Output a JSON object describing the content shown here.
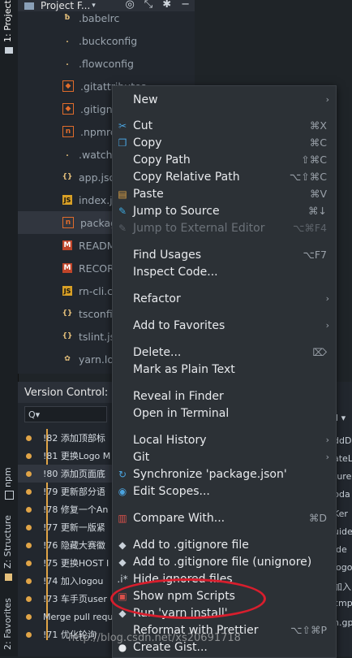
{
  "sidebar": {
    "project_tab": "1: Project",
    "npm_tab": "npm",
    "structure_tab": "Z: Structure",
    "favorites_tab": "2: Favorites"
  },
  "project": {
    "title": "Project F...",
    "files": [
      {
        "name": ".babelrc",
        "icon": "babel-icon"
      },
      {
        "name": ".buckconfig",
        "icon": "config-icon"
      },
      {
        "name": ".flowconfig",
        "icon": "config-icon"
      },
      {
        "name": ".gitattributes",
        "icon": "git-icon"
      },
      {
        "name": ".gitignore",
        "icon": "git-icon"
      },
      {
        "name": ".npmrc",
        "icon": "npm-icon"
      },
      {
        "name": ".watchman",
        "icon": "config-icon"
      },
      {
        "name": "app.json",
        "icon": "json-icon"
      },
      {
        "name": "index.js",
        "icon": "js-icon"
      },
      {
        "name": "package.js",
        "icon": "npm-icon"
      },
      {
        "name": "README.m",
        "icon": "markdown-icon"
      },
      {
        "name": "RECORD.m",
        "icon": "markdown-icon"
      },
      {
        "name": "rn-cli.confi",
        "icon": "js-icon"
      },
      {
        "name": "tsconfig.jsc",
        "icon": "json-icon"
      },
      {
        "name": "tslint.json",
        "icon": "json-icon"
      },
      {
        "name": "yarn.lock",
        "icon": "yarn-icon"
      }
    ]
  },
  "version_control": {
    "title": "Version Control:",
    "search_placeholder": "Q▾",
    "commits": [
      "!82 添加顶部标",
      "!81 更换Logo M",
      "!80 添加页面底",
      "!79 更新部分语",
      "!78 修复一个An",
      "!77 更新一版紧",
      "!76 隐藏大赛徽",
      "!75 更换HOST I",
      "!74 加入logou",
      "!73 车手页user",
      "Merge pull requ",
      "!71 优化轮询"
    ],
    "right_fragments": [
      "ll ▾",
      "ddD",
      "ateL",
      "ture",
      "pda",
      "Ker",
      "uide",
      "ide",
      "logo",
      "加入",
      "cmp",
      "h.gp"
    ]
  },
  "menu": {
    "items": [
      {
        "label": "New",
        "shortcut": "",
        "icon": "",
        "submenu": true,
        "disabled": false
      },
      {
        "label": "Cut",
        "shortcut": "⌘X",
        "icon": "scissors-icon",
        "submenu": false,
        "disabled": false
      },
      {
        "label": "Copy",
        "shortcut": "⌘C",
        "icon": "copy-icon",
        "submenu": false,
        "disabled": false
      },
      {
        "label": "Copy Path",
        "shortcut": "⇧⌘C",
        "icon": "",
        "submenu": false,
        "disabled": false
      },
      {
        "label": "Copy Relative Path",
        "shortcut": "⌥⇧⌘C",
        "icon": "",
        "submenu": false,
        "disabled": false
      },
      {
        "label": "Paste",
        "shortcut": "⌘V",
        "icon": "clipboard-icon",
        "submenu": false,
        "disabled": false
      },
      {
        "label": "Jump to Source",
        "shortcut": "⌘↓",
        "icon": "jump-icon",
        "submenu": false,
        "disabled": false
      },
      {
        "label": "Jump to External Editor",
        "shortcut": "⌥⌘F4",
        "icon": "external-editor-icon",
        "submenu": false,
        "disabled": true
      },
      {
        "label": "Find Usages",
        "shortcut": "⌥F7",
        "icon": "",
        "submenu": false,
        "disabled": false
      },
      {
        "label": "Inspect Code...",
        "shortcut": "",
        "icon": "",
        "submenu": false,
        "disabled": false
      },
      {
        "label": "Refactor",
        "shortcut": "",
        "icon": "",
        "submenu": true,
        "disabled": false
      },
      {
        "label": "Add to Favorites",
        "shortcut": "",
        "icon": "",
        "submenu": true,
        "disabled": false
      },
      {
        "label": "Delete...",
        "shortcut": "⌦",
        "icon": "",
        "submenu": false,
        "disabled": false
      },
      {
        "label": "Mark as Plain Text",
        "shortcut": "",
        "icon": "",
        "submenu": false,
        "disabled": false
      },
      {
        "label": "Reveal in Finder",
        "shortcut": "",
        "icon": "",
        "submenu": false,
        "disabled": false
      },
      {
        "label": "Open in Terminal",
        "shortcut": "",
        "icon": "",
        "submenu": false,
        "disabled": false
      },
      {
        "label": "Local History",
        "shortcut": "",
        "icon": "",
        "submenu": true,
        "disabled": false
      },
      {
        "label": "Git",
        "shortcut": "",
        "icon": "",
        "submenu": true,
        "disabled": false
      },
      {
        "label": "Synchronize 'package.json'",
        "shortcut": "",
        "icon": "sync-icon",
        "submenu": false,
        "disabled": false
      },
      {
        "label": "Edit Scopes...",
        "shortcut": "",
        "icon": "scopes-icon",
        "submenu": false,
        "disabled": false
      },
      {
        "label": "Compare With...",
        "shortcut": "⌘D",
        "icon": "compare-icon",
        "submenu": false,
        "disabled": false
      },
      {
        "label": "Add to .gitignore file",
        "shortcut": "",
        "icon": "gitignore-icon",
        "submenu": false,
        "disabled": false
      },
      {
        "label": "Add to .gitignore file (unignore)",
        "shortcut": "",
        "icon": "gitignore-icon",
        "submenu": false,
        "disabled": false
      },
      {
        "label": "Hide ignored files",
        "shortcut": "",
        "icon": "hide-icon",
        "submenu": false,
        "disabled": false
      },
      {
        "label": "Show npm Scripts",
        "shortcut": "",
        "icon": "npm-icon",
        "submenu": false,
        "disabled": false
      },
      {
        "label": "Run 'yarn install'",
        "shortcut": "",
        "icon": "yarn-icon",
        "submenu": false,
        "disabled": false
      },
      {
        "label": "Reformat with Prettier",
        "shortcut": "⌥⇧⌘P",
        "icon": "",
        "submenu": false,
        "disabled": false
      },
      {
        "label": "Create Gist...",
        "shortcut": "",
        "icon": "github-icon",
        "submenu": false,
        "disabled": false
      }
    ]
  },
  "watermark": "http://blog.csdn.net/xs20691718"
}
